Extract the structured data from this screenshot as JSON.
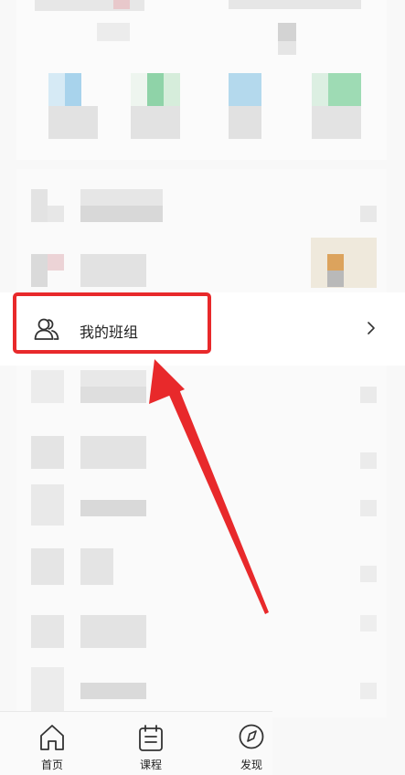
{
  "menu": {
    "focused_item_label": "我的班组"
  },
  "tabbar": {
    "items": [
      {
        "label": "首页",
        "icon": "home-icon"
      },
      {
        "label": "课程",
        "icon": "calendar-icon"
      },
      {
        "label": "发现",
        "icon": "compass-icon"
      }
    ]
  },
  "annotation": {
    "highlight_color": "#e8292b"
  }
}
